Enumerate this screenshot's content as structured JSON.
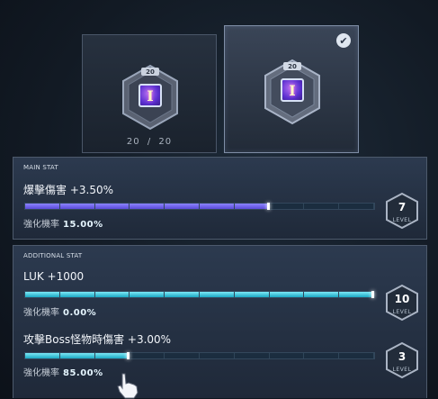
{
  "cards": [
    {
      "level_tag": "20",
      "glyph": "I",
      "count_current": "20",
      "count_sep": "/",
      "count_max": "20",
      "selected": false
    },
    {
      "level_tag": "20",
      "glyph": "I",
      "selected": true
    }
  ],
  "check_icon": "✔",
  "main_stat": {
    "title": "MAIN STAT",
    "name": "爆擊傷害 +3.50%",
    "rate_label": "強化機率",
    "rate_value": "15.00%",
    "progress": 0.7,
    "level": "7",
    "level_label": "LEVEL",
    "color": "#6f64f0"
  },
  "additional_stat": {
    "title": "ADDITIONAL STAT",
    "stats": [
      {
        "name": "LUK +1000",
        "rate_label": "強化機率",
        "rate_value": "0.00%",
        "progress": 1.0,
        "level": "10",
        "level_label": "LEVEL"
      },
      {
        "name": "攻擊Boss怪物時傷害 +3.00%",
        "rate_label": "強化機率",
        "rate_value": "85.00%",
        "progress": 0.3,
        "level": "3",
        "level_label": "LEVEL"
      }
    ],
    "color": "#28b6d0"
  }
}
